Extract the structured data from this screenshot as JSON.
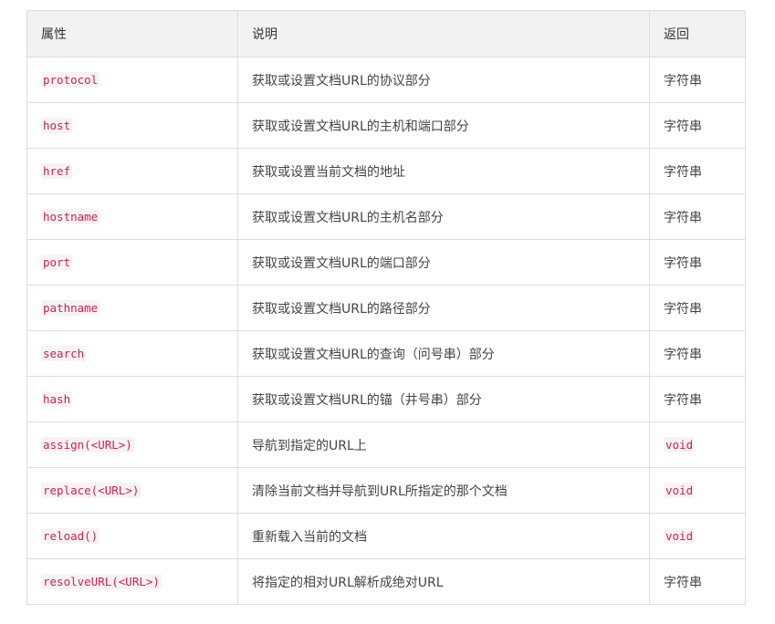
{
  "header": {
    "property": "属性",
    "description": "说明",
    "returns": "返回"
  },
  "rows": [
    {
      "property": "protocol",
      "description": "获取或设置文档URL的协议部分",
      "returns": "字符串",
      "returns_is_code": false
    },
    {
      "property": "host",
      "description": "获取或设置文档URL的主机和端口部分",
      "returns": "字符串",
      "returns_is_code": false
    },
    {
      "property": "href",
      "description": "获取或设置当前文档的地址",
      "returns": "字符串",
      "returns_is_code": false
    },
    {
      "property": "hostname",
      "description": "获取或设置文档URL的主机名部分",
      "returns": "字符串",
      "returns_is_code": false
    },
    {
      "property": "port",
      "description": "获取或设置文档URL的端口部分",
      "returns": "字符串",
      "returns_is_code": false
    },
    {
      "property": "pathname",
      "description": "获取或设置文档URL的路径部分",
      "returns": "字符串",
      "returns_is_code": false
    },
    {
      "property": "search",
      "description": "获取或设置文档URL的查询（问号串）部分",
      "returns": "字符串",
      "returns_is_code": false
    },
    {
      "property": "hash",
      "description": "获取或设置文档URL的锚（井号串）部分",
      "returns": "字符串",
      "returns_is_code": false
    },
    {
      "property": "assign(<URL>)",
      "description": "导航到指定的URL上",
      "returns": "void",
      "returns_is_code": true
    },
    {
      "property": "replace(<URL>)",
      "description": "清除当前文档并导航到URL所指定的那个文档",
      "returns": "void",
      "returns_is_code": true
    },
    {
      "property": "reload()",
      "description": "重新载入当前的文档",
      "returns": "void",
      "returns_is_code": true
    },
    {
      "property": "resolveURL(<URL>)",
      "description": "将指定的相对URL解析成绝对URL",
      "returns": "字符串",
      "returns_is_code": false
    }
  ],
  "colors": {
    "code_text": "#c7254e",
    "code_bg": "#f9f2f4",
    "header_bg": "#f2f2f2",
    "border": "#dddddd"
  }
}
